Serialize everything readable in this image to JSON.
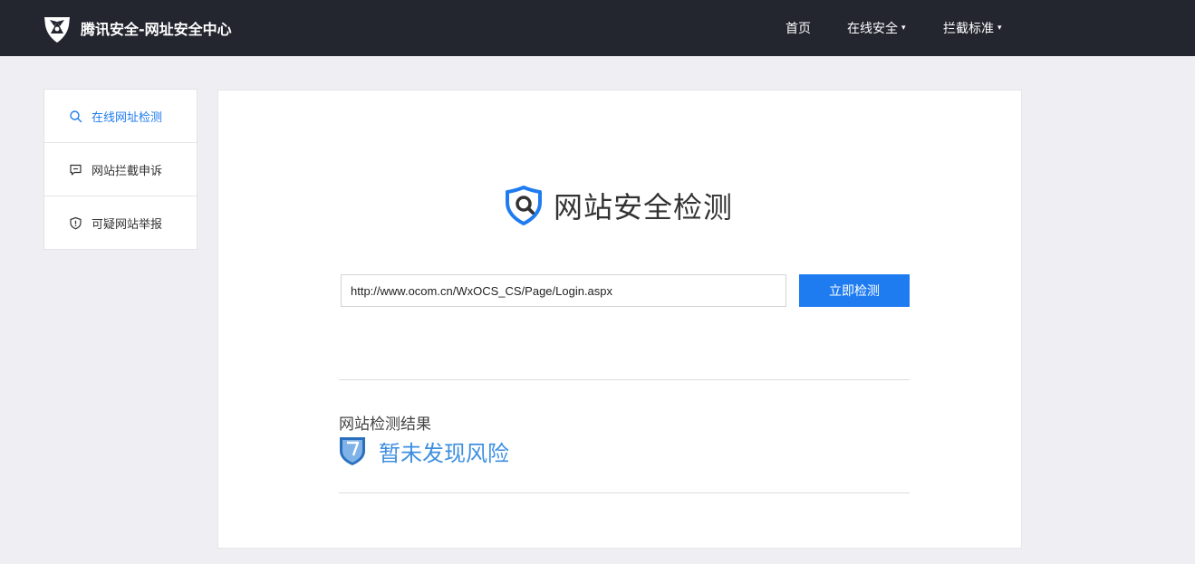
{
  "header": {
    "brand_title": "腾讯安全-网址安全中心",
    "brand_logo_icon": "tencent-security-logo-icon",
    "nav": [
      {
        "label": "首页",
        "has_dropdown": false
      },
      {
        "label": "在线安全",
        "has_dropdown": true
      },
      {
        "label": "拦截标准",
        "has_dropdown": true
      }
    ],
    "caret": "▾"
  },
  "sidebar": {
    "items": [
      {
        "label": "在线网址检测",
        "icon": "search-icon",
        "active": true
      },
      {
        "label": "网站拦截申诉",
        "icon": "chat-bubble-icon",
        "active": false
      },
      {
        "label": "可疑网站举报",
        "icon": "shield-alert-icon",
        "active": false
      }
    ]
  },
  "main": {
    "heading_icon": "shield-search-icon",
    "heading": "网站安全检测",
    "url_input": {
      "value": "http://www.ocom.cn/WxOCS_CS/Page/Login.aspx",
      "placeholder": ""
    },
    "check_button_label": "立即检测",
    "result": {
      "label": "网站检测结果",
      "icon": "shield-safe-icon",
      "status": "暂未发现风险"
    }
  },
  "colors": {
    "header_bg": "#23252f",
    "page_bg": "#efeff3",
    "accent": "#1f7cf0",
    "safe_text": "#3d8fe0",
    "active_nav": "#1f7cf0"
  }
}
